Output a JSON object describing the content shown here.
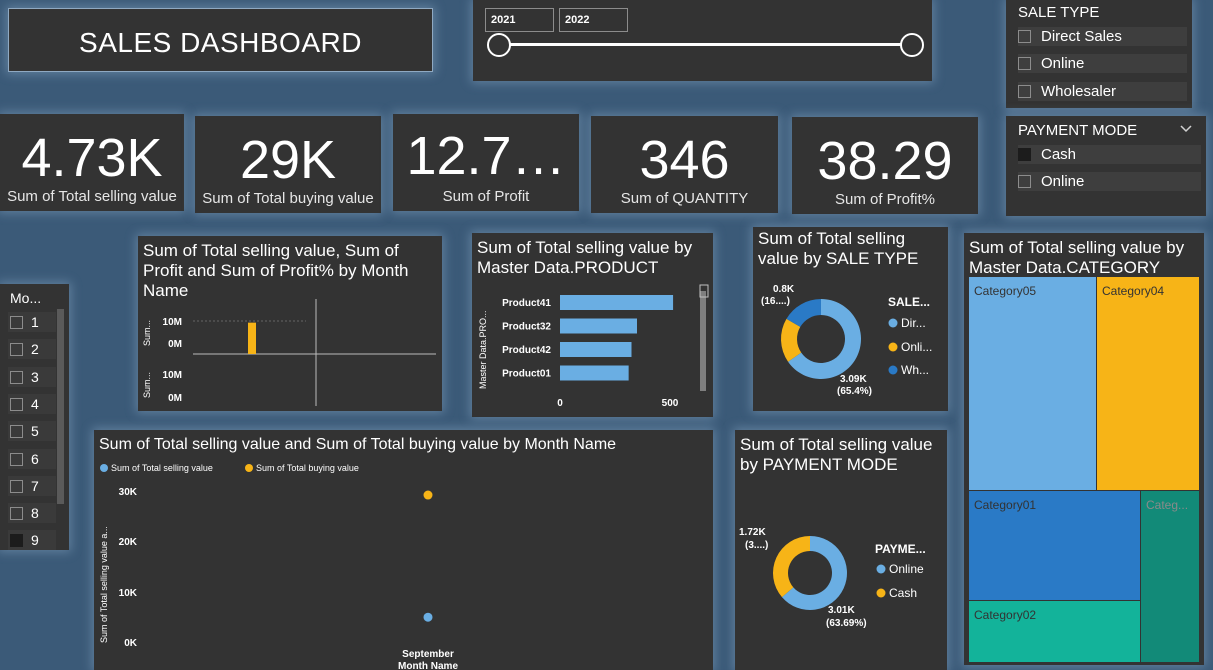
{
  "header": {
    "title": "SALES DASHBOARD"
  },
  "year_slider": {
    "start": "2021",
    "end": "2022"
  },
  "sale_type_slicer": {
    "title": "SALE TYPE",
    "items": [
      {
        "label": "Direct Sales",
        "checked": false
      },
      {
        "label": "Online",
        "checked": false
      },
      {
        "label": "Wholesaler",
        "checked": false
      }
    ]
  },
  "payment_mode_slicer": {
    "title": "PAYMENT MODE",
    "items": [
      {
        "label": "Cash",
        "checked": true
      },
      {
        "label": "Online",
        "checked": false
      }
    ]
  },
  "kpis": [
    {
      "value": "4.73K",
      "label": "Sum of Total selling value"
    },
    {
      "value": "29K",
      "label": "Sum of Total buying value"
    },
    {
      "value": "12.7…",
      "label": "Sum of Profit"
    },
    {
      "value": "346",
      "label": "Sum of QUANTITY"
    },
    {
      "value": "38.29",
      "label": "Sum of Profit%"
    }
  ],
  "month_slicer": {
    "title": "Mo...",
    "items": [
      "1",
      "2",
      "3",
      "4",
      "5",
      "6",
      "7",
      "8",
      "9"
    ],
    "checked_index": 8
  },
  "colors": {
    "blue": "#6aaee3",
    "orange": "#f7b417",
    "darkblue": "#2a7ac6",
    "teal1": "#128a78",
    "teal2": "#13b39a",
    "bg": "#3b5a78",
    "card": "#333333"
  },
  "combo_chart": {
    "title": "Sum of Total selling value, Sum of Profit and Sum of Profit% by Month Name",
    "top_axis_label": "Sum...",
    "bottom_axis_label": "Sum...",
    "top_ticks": [
      "10M",
      "0M"
    ],
    "bottom_ticks": [
      "10M",
      "0M"
    ],
    "bar_value_fraction": 0.95
  },
  "product_chart": {
    "title": "Sum of Total selling value by Master Data.PRODUCT",
    "ylabel": "Master Data.PRO...",
    "x_ticks": [
      "0",
      "500"
    ],
    "max": 700,
    "bars": [
      {
        "label": "Product41",
        "value": 514
      },
      {
        "label": "Product32",
        "value": 350
      },
      {
        "label": "Product42",
        "value": 325
      },
      {
        "label": "Product01",
        "value": 312
      }
    ]
  },
  "sale_type_donut": {
    "title": "Sum of Total selling value by SALE TYPE",
    "legend_title": "SALE...",
    "legend": [
      "Dir...",
      "Onli...",
      "Wh..."
    ],
    "label_small_1": "0.8K",
    "label_small_2": "(16....)",
    "label_big_1": "3.09K",
    "label_big_2": "(65.4%)",
    "slices": [
      0.654,
      0.18,
      0.166
    ]
  },
  "category_treemap": {
    "title": "Sum of Total selling value by Master Data.CATEGORY",
    "labels": [
      "Category05",
      "Category04",
      "Category01",
      "Categ...",
      "Category02"
    ]
  },
  "month_chart": {
    "title": "Sum of Total selling value and Sum of Total buying value by Month Name",
    "legend": [
      "Sum of Total selling value",
      "Sum of Total buying value"
    ],
    "ylabel": "Sum of Total selling value a...",
    "xlabel": "Month Name",
    "y_ticks": [
      "30K",
      "20K",
      "10K",
      "0K"
    ],
    "ymax": 30000,
    "category": "September",
    "selling": 4730,
    "buying": 29000
  },
  "payment_donut": {
    "title": "Sum of Total selling value by PAYMENT MODE",
    "legend_title": "PAYME...",
    "legend": [
      "Online",
      "Cash"
    ],
    "label_small_1": "1.72K",
    "label_small_2": "(3....)",
    "label_big_1": "3.01K",
    "label_big_2": "(63.69%)",
    "slices": [
      0.6369,
      0.3631
    ]
  }
}
